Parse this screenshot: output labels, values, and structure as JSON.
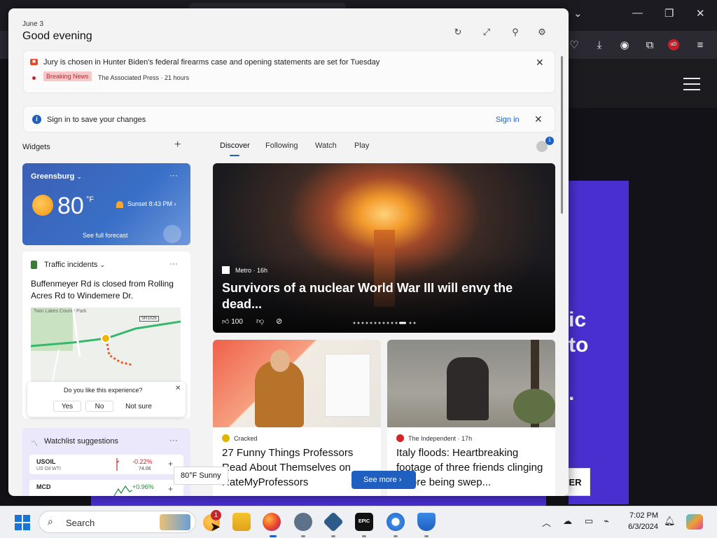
{
  "panel": {
    "date": "June 3",
    "greeting": "Good evening",
    "breaking": {
      "headline": "Jury is chosen in Hunter Biden's federal firearms case and opening statements are set for Tuesday",
      "tag": "Breaking News",
      "source": "The Associated Press · 21 hours"
    },
    "signin": {
      "text": "Sign in to save your changes",
      "link": "Sign in"
    }
  },
  "widgets": {
    "label": "Widgets",
    "weather": {
      "location": "Greensburg",
      "temp": "80",
      "unit": "°F",
      "sunset": "Sunset 8:43 PM",
      "forecast": "See full forecast"
    },
    "traffic": {
      "title": "Traffic incidents",
      "text": "Buffenmeyer Rd is closed from Rolling Acres Rd to Windemere Dr.",
      "map_label": "Twin Lakes County Park",
      "road_label": "SR1026",
      "survey": {
        "question": "Do you like this experience?",
        "options": [
          "Yes",
          "No",
          "Not sure"
        ]
      }
    },
    "watchlist": {
      "title": "Watchlist suggestions",
      "stocks": [
        {
          "symbol": "USOIL",
          "name": "US Oil WTI",
          "change": "-0.22%",
          "value": "74.06",
          "color": "#c4262e"
        },
        {
          "symbol": "MCD",
          "name": "",
          "change": "+0.96%",
          "value": "",
          "color": "#1e8a3a"
        }
      ]
    }
  },
  "feed": {
    "tabs": [
      "Discover",
      "Following",
      "Watch",
      "Play"
    ],
    "notif": "1",
    "hero": {
      "source": "Metro · 16h",
      "title": "Survivors of a nuclear World War III will envy the dead...",
      "likes": "100"
    },
    "cards": [
      {
        "source": "Cracked",
        "title": "27 Funny Things Professors Read About Themselves on RateMyProfessors",
        "icon_color": "#e0b400"
      },
      {
        "source": "The Independent · 17h",
        "title": "Italy floods: Heartbreaking footage of three friends clinging before being swep...",
        "icon_color": "#d5232b"
      }
    ],
    "see_more": "See more",
    "weather_tip": "80°F Sunny"
  },
  "browser": {
    "snippet_lines": [
      "ic",
      "to",
      "."
    ],
    "cta": "ER"
  },
  "taskbar": {
    "search": "Search",
    "badge": "1",
    "time": "7:02 PM",
    "date": "6/3/2024"
  }
}
